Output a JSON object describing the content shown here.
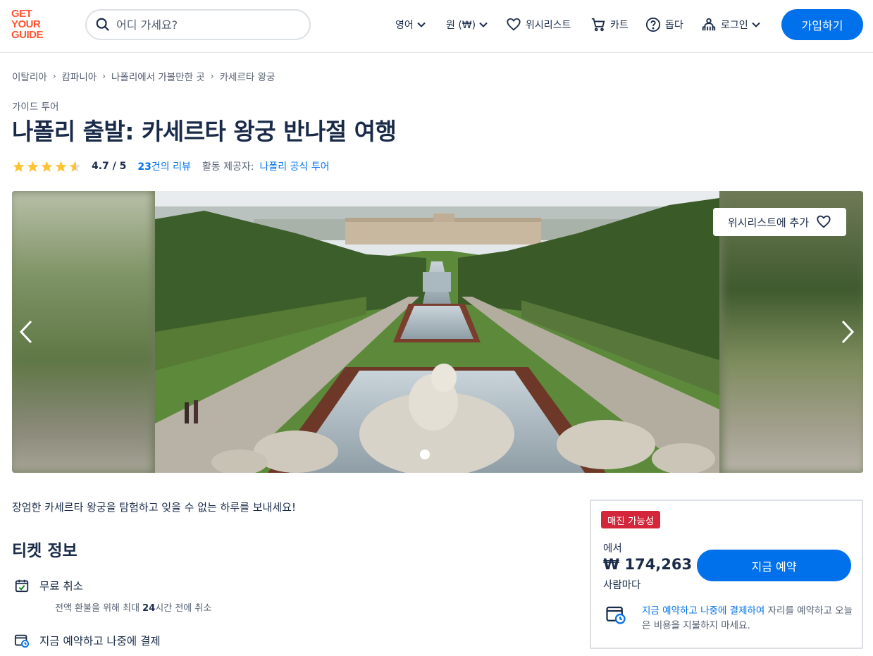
{
  "header": {
    "logo": [
      "GET",
      "YOUR",
      "GUIDE"
    ],
    "search_placeholder": "어디 가세요?",
    "language": "영어",
    "currency": "원 (₩)",
    "wishlist": "위시리스트",
    "cart": "카트",
    "help": "돕다",
    "login": "로그인",
    "signup": "가입하기"
  },
  "breadcrumbs": [
    "이탈리아",
    "캄파니아",
    "나폴리에서 가볼만한 곳",
    "카세르타 왕궁"
  ],
  "category": "가이드 투어",
  "title": "나폴리 출발: 카세르타 왕궁 반나절 여행",
  "rating": {
    "value": "4.7 / 5",
    "stars": 4.7,
    "review_count": "23",
    "review_suffix": "건의 리뷰",
    "provider_label": "활동 제공자:",
    "provider": "나폴리 공식 투어"
  },
  "gallery": {
    "wishlist_add": "위시리스트에 추가",
    "active_slide": 1
  },
  "intro": "장엄한 카세르타 왕궁을 탐험하고 잊을 수 없는 하루를 보내세요!",
  "ticket": {
    "heading": "티켓 정보",
    "features": [
      {
        "icon": "calendar-check-icon",
        "title": "무료 취소",
        "sub_prefix": "전액 환불을 위해 최대 ",
        "sub_bold": "24",
        "sub_suffix": "시간 전에 취소"
      },
      {
        "icon": "calendar-clock-icon",
        "title": "지금 예약하고 나중에 결제"
      }
    ]
  },
  "booking": {
    "badge": "매진 가능성",
    "from": "에서",
    "price": "₩ 174,263",
    "per": "사람마다",
    "book_button": "지금 예약",
    "rnpl_link": "지금 예약하고 나중에 결제하여",
    "rnpl_text": " 자리를 예약하고 오늘은 비용을 지불하지 마세요."
  },
  "colors": {
    "brand": "#ff5533",
    "primary": "#0071eb",
    "text": "#1a2b49",
    "badge": "#d4263a",
    "star": "#fdc432"
  }
}
